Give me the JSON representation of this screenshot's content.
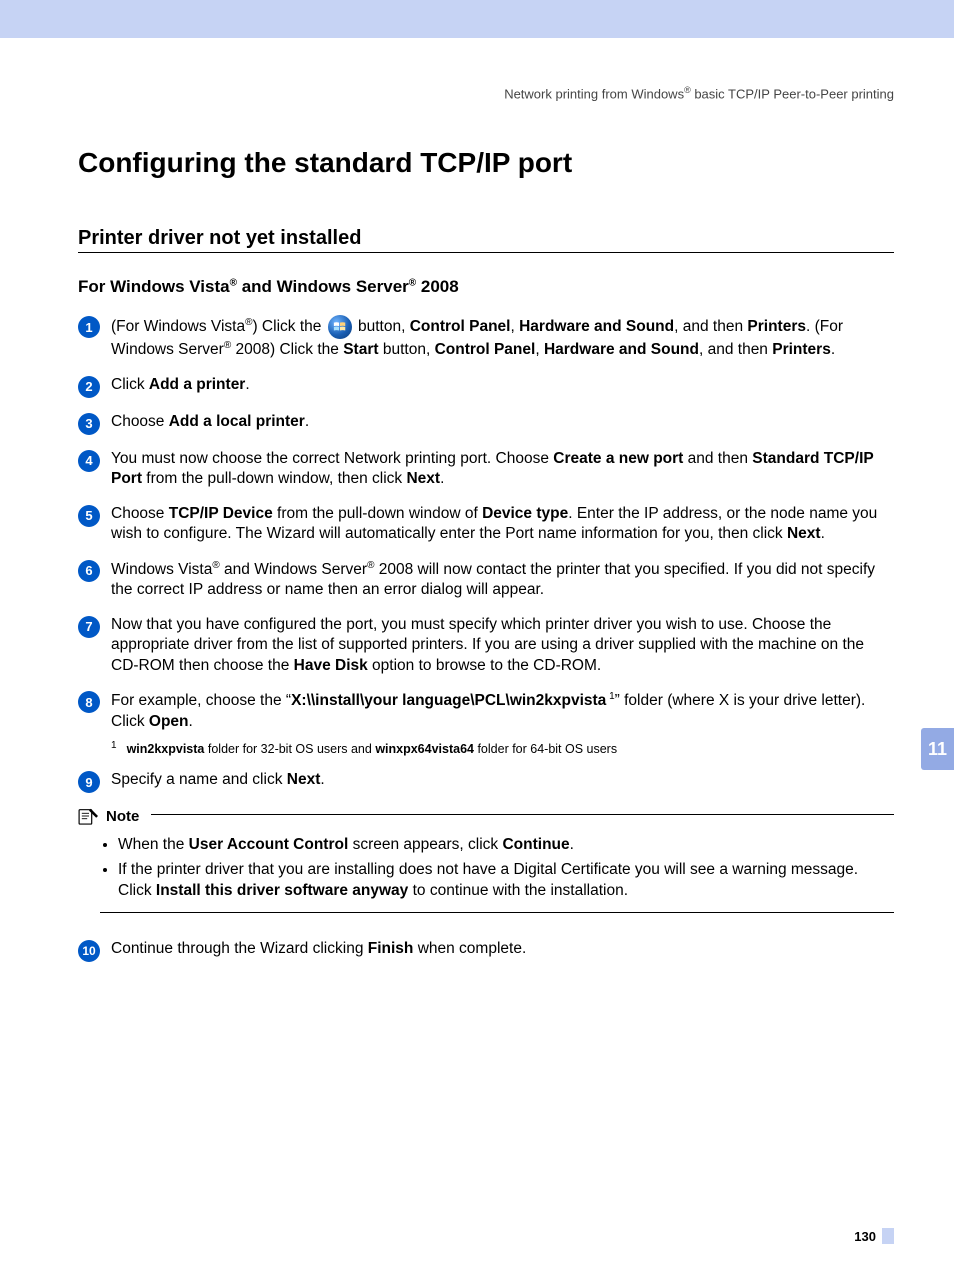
{
  "header": {
    "pre": "Network printing from Windows",
    "post": " basic TCP/IP Peer-to-Peer printing"
  },
  "title": "Configuring the standard TCP/IP port",
  "section": "Printer driver not yet installed",
  "subsection": {
    "pre": "For Windows Vista",
    "mid": " and Windows Server",
    "post": " 2008"
  },
  "steps": {
    "s1": {
      "n": "1",
      "a": "(For Windows Vista",
      "b": ") Click the ",
      "c": " button, ",
      "d": "Control Panel",
      "e": ", ",
      "f": "Hardware and Sound",
      "g": ", and then ",
      "h": "Printers",
      "i": ". (For Windows Server",
      "j": " 2008) Click the ",
      "k": "Start",
      "l": " button, ",
      "m": "Control Panel",
      "n2": ", ",
      "o": "Hardware and Sound",
      "p": ", and then ",
      "q": "Printers",
      "r": "."
    },
    "s2": {
      "n": "2",
      "a": "Click ",
      "b": "Add a printer",
      "c": "."
    },
    "s3": {
      "n": "3",
      "a": "Choose ",
      "b": "Add a local printer",
      "c": "."
    },
    "s4": {
      "n": "4",
      "a": "You must now choose the correct Network printing port. Choose ",
      "b": "Create a new port",
      "c": " and then ",
      "d": "Standard TCP/IP Port",
      "e": " from the pull-down window, then click ",
      "f": "Next",
      "g": "."
    },
    "s5": {
      "n": "5",
      "a": "Choose ",
      "b": "TCP/IP Device",
      "c": " from the pull-down window of ",
      "d": "Device type",
      "e": ". Enter the IP address, or the node name you wish to configure. The Wizard will automatically enter the Port name information for you, then click ",
      "f": "Next",
      "g": "."
    },
    "s6": {
      "n": "6",
      "a": "Windows Vista",
      "b": " and Windows Server",
      "c": " 2008 will now contact the printer that you specified. If you did not specify the correct IP address or name then an error dialog will appear."
    },
    "s7": {
      "n": "7",
      "a": "Now that you have configured the port, you must specify which printer driver you wish to use. Choose the appropriate driver from the list of supported printers. If you are using a driver supplied with the machine on the CD-ROM then choose the ",
      "b": "Have Disk",
      "c": " option to browse to the CD-ROM."
    },
    "s8": {
      "n": "8",
      "a": "For example, choose the “",
      "b": "X:\\\\install\\your language\\PCL\\win2kxpvista",
      "c": "” folder (where X is your drive letter). Click ",
      "d": "Open",
      "e": "."
    },
    "s9": {
      "n": "9",
      "a": "Specify a name and click ",
      "b": "Next",
      "c": "."
    },
    "s10": {
      "n": "10",
      "a": "Continue through the Wizard clicking ",
      "b": "Finish",
      "c": " when complete."
    }
  },
  "footnote": {
    "num": "1",
    "a": "win2kxpvista",
    "b": " folder for 32-bit OS users and ",
    "c": "winxpx64vista64",
    "d": " folder for 64-bit OS users"
  },
  "note": {
    "label": "Note",
    "items": {
      "i1": {
        "a": "When the ",
        "b": "User Account Control",
        "c": " screen appears, click ",
        "d": "Continue",
        "e": "."
      },
      "i2": {
        "a": "If the printer driver that you are installing does not have a Digital Certificate you will see a warning message. Click ",
        "b": "Install this driver software anyway",
        "c": " to continue with the installation."
      }
    }
  },
  "sideTab": "11",
  "pageNumber": "130"
}
